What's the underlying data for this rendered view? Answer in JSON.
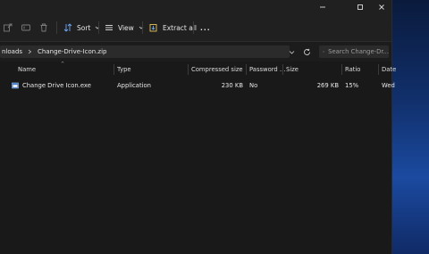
{
  "toolbar": {
    "sort_label": "Sort",
    "view_label": "View",
    "extract_label": "Extract all",
    "more_label": "..."
  },
  "address": {
    "crumbs": [
      "nloads",
      "Change-Drive-Icon.zip"
    ],
    "search_placeholder": "Search Change-Dr..."
  },
  "columns": [
    "Name",
    "Type",
    "Compressed size",
    "Password ...",
    "Size",
    "Ratio",
    "Date"
  ],
  "rows": [
    {
      "name": "Change Drive Icon.exe",
      "type": "Application",
      "compressed_size": "230 KB",
      "password": "No",
      "size": "269 KB",
      "ratio": "15%",
      "date": "Wed"
    }
  ]
}
